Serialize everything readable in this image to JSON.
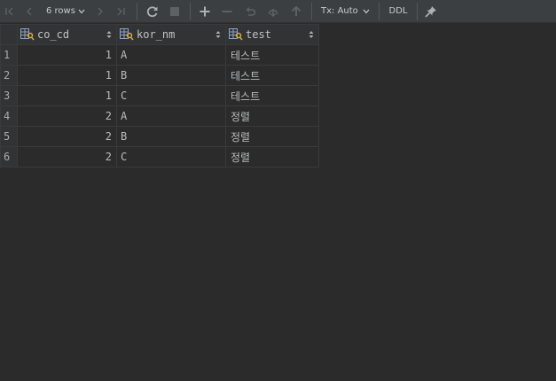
{
  "toolbar": {
    "rows_label": "6 rows",
    "tx_label": "Tx: Auto",
    "ddl_label": "DDL"
  },
  "grid": {
    "columns": [
      {
        "name": "co_cd"
      },
      {
        "name": "kor_nm"
      },
      {
        "name": "test"
      }
    ],
    "rows": [
      {
        "num": "1",
        "co_cd": "1",
        "kor_nm": "A",
        "test": "테스트"
      },
      {
        "num": "2",
        "co_cd": "1",
        "kor_nm": "B",
        "test": "테스트"
      },
      {
        "num": "3",
        "co_cd": "1",
        "kor_nm": "C",
        "test": "테스트"
      },
      {
        "num": "4",
        "co_cd": "2",
        "kor_nm": "A",
        "test": "정렬"
      },
      {
        "num": "5",
        "co_cd": "2",
        "kor_nm": "B",
        "test": "정렬"
      },
      {
        "num": "6",
        "co_cd": "2",
        "kor_nm": "C",
        "test": "정렬"
      }
    ]
  },
  "colors": {
    "background": "#2b2b2b",
    "toolbar": "#3c3f41",
    "key_icon": "#d6a93a",
    "column_icon": "#8fa4c7"
  },
  "icons": [
    "first-page-icon",
    "previous-page-icon",
    "next-page-icon",
    "last-page-icon",
    "refresh-icon",
    "stop-icon",
    "add-row-icon",
    "delete-row-icon",
    "revert-icon",
    "submit-icon",
    "commit-icon",
    "pin-icon",
    "column-key-icon",
    "sort-icon"
  ]
}
